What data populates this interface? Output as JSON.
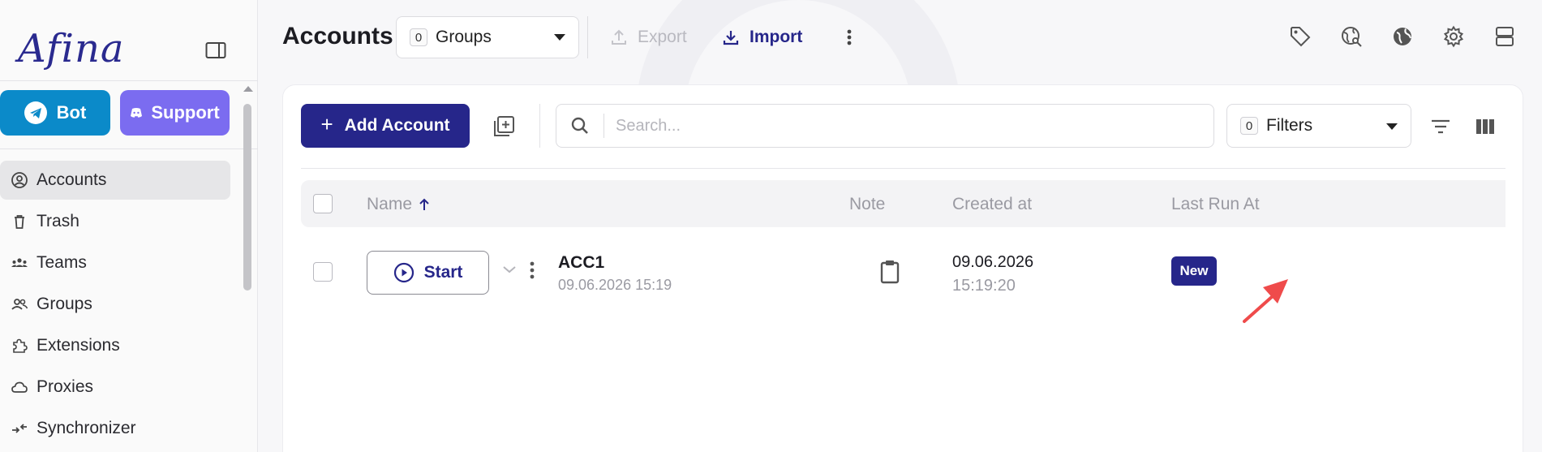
{
  "app": {
    "logo_text": "Afina"
  },
  "sidebar": {
    "bot_label": "Bot",
    "support_label": "Support",
    "items": [
      {
        "label": "Accounts",
        "icon": "user-circle-icon",
        "active": true
      },
      {
        "label": "Trash",
        "icon": "trash-icon"
      },
      {
        "label": "Teams",
        "icon": "teams-icon"
      },
      {
        "label": "Groups",
        "icon": "groups-icon"
      },
      {
        "label": "Extensions",
        "icon": "puzzle-icon"
      },
      {
        "label": "Proxies",
        "icon": "cloud-icon"
      },
      {
        "label": "Synchronizer",
        "icon": "sync-icon"
      }
    ]
  },
  "header": {
    "title": "Accounts",
    "groups_count": "0",
    "groups_label": "Groups",
    "export_label": "Export",
    "import_label": "Import",
    "icons": [
      "tag-icon",
      "globe-key-icon",
      "globe-icon",
      "gear-icon",
      "layout-icon"
    ]
  },
  "toolbar": {
    "add_account_label": "Add Account",
    "search_placeholder": "Search...",
    "filters_count": "0",
    "filters_label": "Filters"
  },
  "table": {
    "columns": {
      "name": "Name",
      "note": "Note",
      "created": "Created at",
      "last_run": "Last Run At"
    },
    "rows": [
      {
        "start_label": "Start",
        "name": "ACC1",
        "date": "09.06.2026 15:19",
        "created_date": "09.06.2026",
        "created_time": "15:19:20",
        "last_run_badge": "New"
      }
    ]
  },
  "colors": {
    "primary": "#26268a",
    "bot": "#0b8ac9",
    "support": "#7b6cf0",
    "annotation_arrow": "#ef4b4b"
  }
}
